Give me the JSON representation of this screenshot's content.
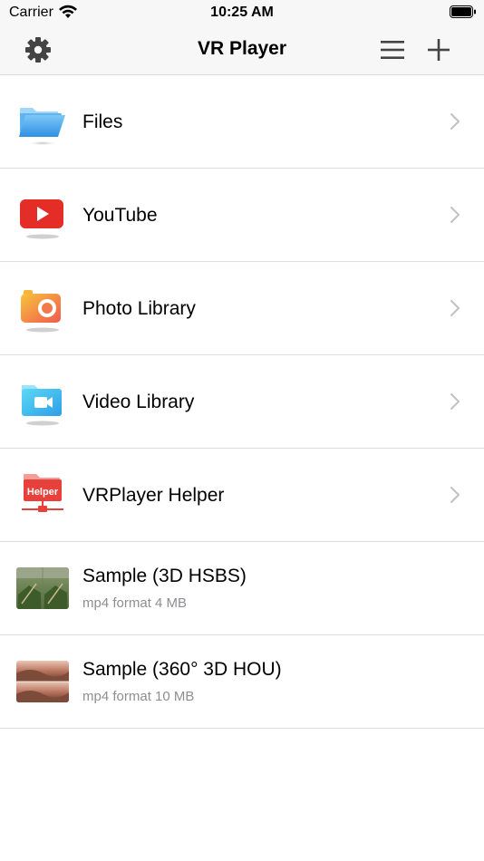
{
  "status": {
    "carrier": "Carrier",
    "time": "10:25 AM"
  },
  "nav": {
    "title": "VR Player",
    "icons": [
      "gear-icon",
      "menu-icon",
      "plus-icon"
    ]
  },
  "rows": [
    {
      "label": "Files",
      "icon": "folder-icon"
    },
    {
      "label": "YouTube",
      "icon": "youtube-icon"
    },
    {
      "label": "Photo Library",
      "icon": "camera-icon"
    },
    {
      "label": "Video Library",
      "icon": "video-folder-icon"
    },
    {
      "label": "VRPlayer Helper",
      "icon": "helper-icon",
      "badge": "Helper"
    }
  ],
  "media": [
    {
      "title": "Sample (3D HSBS)",
      "sub": "mp4 format 4 MB"
    },
    {
      "title": "Sample (360° 3D HOU)",
      "sub": "mp4 format 10 MB"
    }
  ],
  "colors": {
    "navbar_bg": "#f7f7f7",
    "separator": "#dedede",
    "subtitle": "#8e8e93",
    "youtube_red": "#e52d27"
  }
}
